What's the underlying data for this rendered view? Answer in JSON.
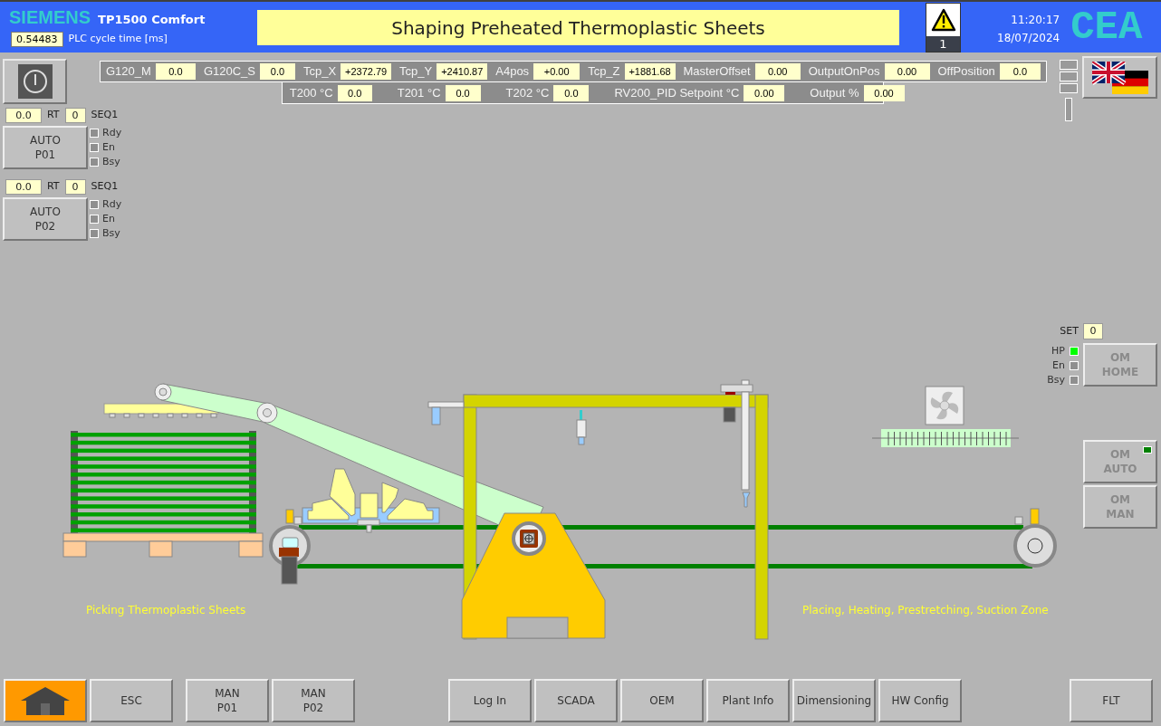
{
  "header": {
    "brand": "SIEMENS",
    "model": "TP1500 Comfort",
    "cycle_value": "0.54483",
    "cycle_label": "PLC cycle time [ms]",
    "title": "Shaping Preheated Thermoplastic Sheets",
    "alarm_count": "1",
    "time": "11:20:17",
    "date": "18/07/2024",
    "logo": "CEA"
  },
  "readouts_row1": [
    {
      "label": "G120_M",
      "value": "0.0"
    },
    {
      "label": "G120C_S",
      "value": "0.0"
    },
    {
      "label": "Tcp_X",
      "value": "+2372.79"
    },
    {
      "label": "Tcp_Y",
      "value": "+2410.87"
    },
    {
      "label": "A4pos",
      "value": "+0.00"
    },
    {
      "label": "Tcp_Z",
      "value": "+1881.68"
    },
    {
      "label": "MasterOffset",
      "value": "0.00"
    },
    {
      "label": "OutputOnPos",
      "value": "0.00"
    },
    {
      "label": "OffPosition",
      "value": "0.0"
    }
  ],
  "readouts_row2": [
    {
      "label": "T200 °C",
      "value": "0.0"
    },
    {
      "label": "T201 °C",
      "value": "0.0"
    },
    {
      "label": "T202 °C",
      "value": "0.0"
    },
    {
      "label": "RV200_PID Setpoint °C",
      "value": "0.00"
    },
    {
      "label": "Output %",
      "value": "0.00"
    }
  ],
  "stations": [
    {
      "value": "0.0",
      "rt_label": "RT",
      "rt_value": "0",
      "seq": "SEQ1",
      "button": [
        "AUTO",
        "P01"
      ],
      "indicators": [
        {
          "label": "Rdy",
          "on": false
        },
        {
          "label": "En",
          "on": false
        },
        {
          "label": "Bsy",
          "on": false
        }
      ]
    },
    {
      "value": "0.0",
      "rt_label": "RT",
      "rt_value": "0",
      "seq": "SEQ1",
      "button": [
        "AUTO",
        "P02"
      ],
      "indicators": [
        {
          "label": "Rdy",
          "on": false
        },
        {
          "label": "En",
          "on": false
        },
        {
          "label": "Bsy",
          "on": false
        }
      ]
    }
  ],
  "mode_panel": {
    "set_label": "SET",
    "set_value": "0",
    "indicators": [
      {
        "label": "HP",
        "on": true
      },
      {
        "label": "En",
        "on": false
      },
      {
        "label": "Bsy",
        "on": false
      }
    ],
    "buttons": [
      {
        "lines": [
          "OM",
          "HOME"
        ],
        "lamp_on": false
      },
      {
        "lines": [
          "OM",
          "AUTO"
        ],
        "lamp_on": true
      },
      {
        "lines": [
          "OM",
          "MAN"
        ],
        "lamp_on": false
      }
    ]
  },
  "zone_labels": [
    "Picking Thermoplastic Sheets",
    "Placing, Heating, Prestretching, Suction Zone"
  ],
  "footer_groups": [
    [
      {
        "kind": "home",
        "selected": true
      },
      {
        "kind": "text",
        "lines": [
          "ESC"
        ],
        "selected": false
      }
    ],
    [
      {
        "kind": "text",
        "lines": [
          "MAN",
          "P01"
        ],
        "selected": false
      },
      {
        "kind": "text",
        "lines": [
          "MAN",
          "P02"
        ],
        "selected": false
      }
    ],
    [
      {
        "kind": "text",
        "lines": [
          "Log In"
        ],
        "selected": false
      },
      {
        "kind": "text",
        "lines": [
          "SCADA"
        ],
        "selected": false
      },
      {
        "kind": "text",
        "lines": [
          "OEM"
        ],
        "selected": false
      },
      {
        "kind": "text",
        "lines": [
          "Plant Info"
        ],
        "selected": false
      },
      {
        "kind": "text",
        "lines": [
          "Dimensioning"
        ],
        "selected": false
      },
      {
        "kind": "text",
        "lines": [
          "HW Config"
        ],
        "selected": false
      }
    ],
    [
      {
        "kind": "text",
        "lines": [
          "FLT"
        ],
        "selected": false
      }
    ]
  ]
}
